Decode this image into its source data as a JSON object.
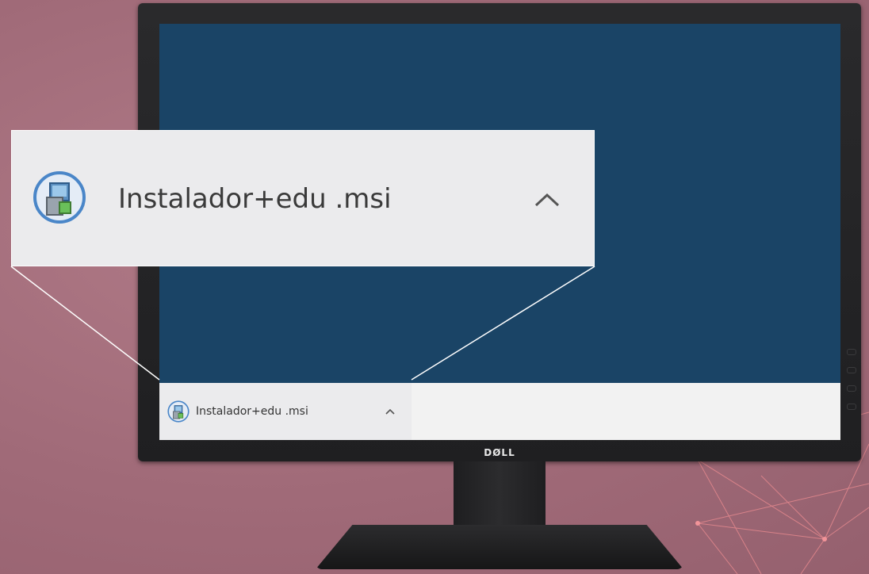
{
  "monitor": {
    "brand": "DØLL"
  },
  "download": {
    "filename": "Instalador+edu .msi",
    "icon": "msi-installer-icon",
    "menu_icon": "chevron-up-icon"
  },
  "callout": {
    "filename": "Instalador+edu .msi"
  },
  "colors": {
    "background": "#a06a78",
    "screen": "#1a4466",
    "taskbar": "#f2f2f2",
    "download_item": "#ebebed"
  }
}
